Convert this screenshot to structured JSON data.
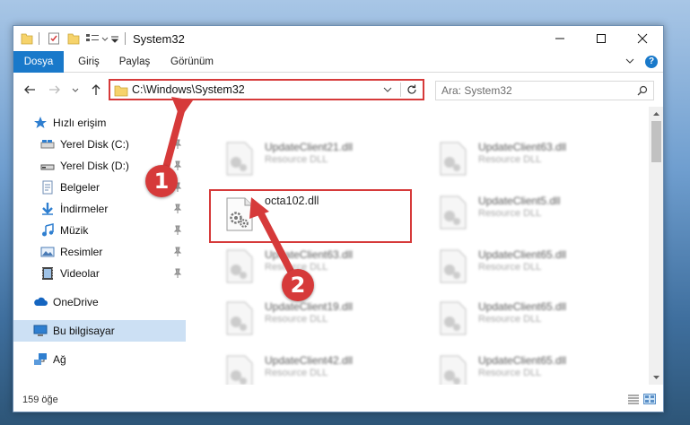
{
  "window": {
    "title": "System32"
  },
  "ribbon": {
    "tabs": [
      "Dosya",
      "Giriş",
      "Paylaş",
      "Görünüm"
    ]
  },
  "address": {
    "path": "C:\\Windows\\System32"
  },
  "search": {
    "placeholder": "Ara: System32"
  },
  "sidebar": {
    "items": [
      {
        "label": "Hızlı erişim",
        "icon": "star-icon",
        "pinned": false
      },
      {
        "label": "Yerel Disk (C:)",
        "icon": "drive-icon",
        "pinned": true
      },
      {
        "label": "Yerel Disk (D:)",
        "icon": "drive-icon",
        "pinned": true
      },
      {
        "label": "Belgeler",
        "icon": "documents-icon",
        "pinned": true
      },
      {
        "label": "İndirmeler",
        "icon": "download-icon",
        "pinned": true
      },
      {
        "label": "Müzik",
        "icon": "music-icon",
        "pinned": true
      },
      {
        "label": "Resimler",
        "icon": "pictures-icon",
        "pinned": true
      },
      {
        "label": "Videolar",
        "icon": "video-icon",
        "pinned": true
      },
      {
        "label": "OneDrive",
        "icon": "cloud-icon",
        "pinned": false
      },
      {
        "label": "Bu bilgisayar",
        "icon": "computer-icon",
        "pinned": false
      },
      {
        "label": "Ağ",
        "icon": "network-icon",
        "pinned": false
      }
    ]
  },
  "files": {
    "col1": [
      {
        "name": "UpdateClient21.dll",
        "type": "Resource DLL"
      },
      {
        "name": "octa102.dll",
        "type": ""
      },
      {
        "name": "UpdateClient63.dll",
        "type": "Resource DLL"
      },
      {
        "name": "UpdateClient19.dll",
        "type": "Resource DLL"
      },
      {
        "name": "UpdateClient42.dll",
        "type": "Resource DLL"
      }
    ],
    "col2": [
      {
        "name": "UpdateClient63.dll",
        "type": "Resource DLL"
      },
      {
        "name": "UpdateClient5.dll",
        "type": "Resource DLL"
      },
      {
        "name": "UpdateClient65.dll",
        "type": "Resource DLL"
      },
      {
        "name": "UpdateClient65.dll",
        "type": "Resource DLL"
      },
      {
        "name": "UpdateClient65.dll",
        "type": "Resource DLL"
      }
    ]
  },
  "status": {
    "count": "159 öğe"
  },
  "callouts": [
    "1",
    "2"
  ],
  "colors": {
    "accent": "#1979ca",
    "highlight": "#d63a3a",
    "selected": "#cce0f4"
  }
}
